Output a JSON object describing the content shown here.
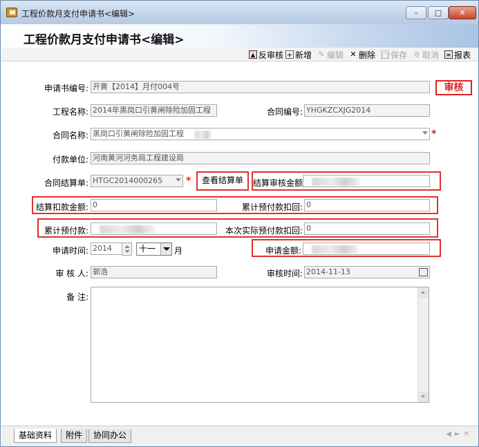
{
  "window": {
    "title": "工程价款月支付申请书<编辑>",
    "controls": [
      "minimize",
      "maximize",
      "close"
    ]
  },
  "banner": {
    "title": "工程价款月支付申请书<编辑>"
  },
  "toolbar": {
    "items": [
      {
        "label": "反审核",
        "icon": "unaudit-icon",
        "enabled": true
      },
      {
        "label": "新增",
        "icon": "add-doc-icon",
        "enabled": true
      },
      {
        "label": "编辑",
        "icon": "edit-icon",
        "enabled": false
      },
      {
        "label": "删除",
        "icon": "delete-x-icon",
        "enabled": true
      },
      {
        "label": "保存",
        "icon": "save-icon",
        "enabled": false
      },
      {
        "label": "取消",
        "icon": "cancel-icon",
        "enabled": false
      },
      {
        "label": "报表",
        "icon": "report-icon",
        "enabled": true
      }
    ]
  },
  "stamp": "审核",
  "form": {
    "app_no_label": "申请书编号:",
    "app_no_value": "开黄【2014】月付004号",
    "project_name_label": "工程名称:",
    "project_name_value": "2014年黑岗口引黄闸除险加固工程",
    "contract_no_label": "合同编号:",
    "contract_no_value": "YHGKZCXJG2014",
    "contract_name_label": "合同名称:",
    "contract_name_value": "黑岗口引黄闸除险加固工程",
    "payer_label": "付款单位:",
    "payer_value": "河南黄河河务局工程建设局",
    "settlement_label": "合同结算单:",
    "settlement_value": "HTGC2014000265",
    "view_settlement_button": "查看结算单",
    "audit_amount_label": "结算审核金额:",
    "deduct_amount_label": "结算扣款金额:",
    "deduct_amount_value": "0",
    "advance_deduct_label": "累计预付款扣回:",
    "advance_deduct_value": "0",
    "advance_total_label": "累计预付款:",
    "actual_advance_label": "本次实际预付款扣回:",
    "actual_advance_value": "0",
    "apply_time_label": "申请时间:",
    "apply_year": "2014",
    "apply_month": "十一",
    "month_unit": "月",
    "apply_amount_label": "申请金额:",
    "auditor_label": "审 核 人:",
    "auditor_value": "郭浩",
    "audit_time_label": "审核时间:",
    "audit_time_value": "2014-11-13",
    "notes_label": "备    注:"
  },
  "tabs": [
    "基础资料",
    "附件",
    "协同办公"
  ],
  "colors": {
    "highlight_box": "#e03030",
    "required_star": "#e02020"
  }
}
